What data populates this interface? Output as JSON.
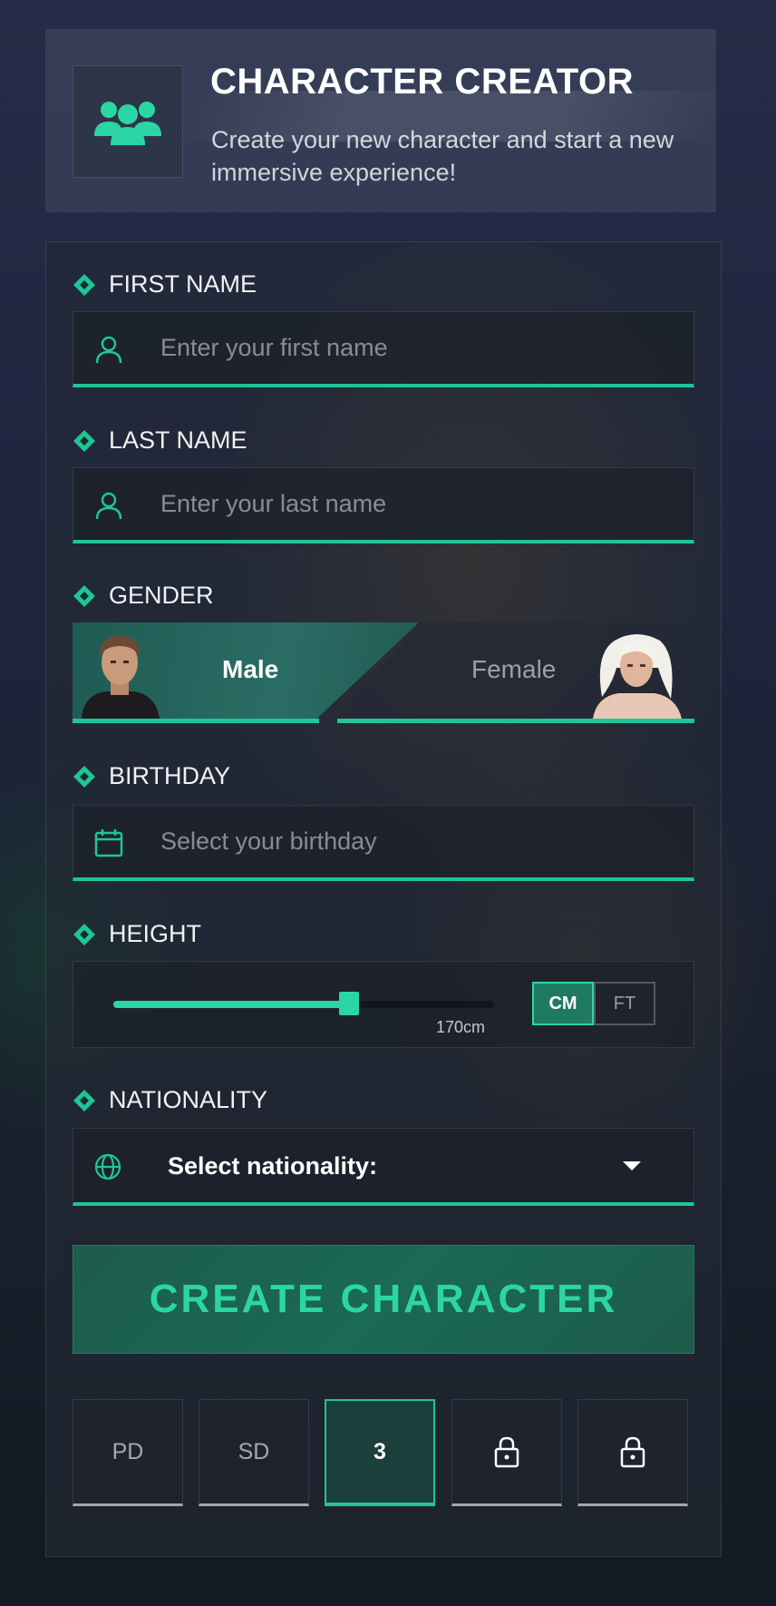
{
  "header": {
    "title": "CHARACTER CREATOR",
    "subtitle": "Create your new character and start a new immersive experience!",
    "icon": "users-icon"
  },
  "form": {
    "first_name": {
      "label": "FIRST NAME",
      "placeholder": "Enter your first name",
      "icon": "user-icon"
    },
    "last_name": {
      "label": "LAST NAME",
      "placeholder": "Enter your last name",
      "icon": "user-icon"
    },
    "gender": {
      "label": "GENDER",
      "options": [
        "Male",
        "Female"
      ],
      "selected": "Male"
    },
    "birthday": {
      "label": "BIRTHDAY",
      "placeholder": "Select your birthday",
      "icon": "calendar-icon"
    },
    "height": {
      "label": "HEIGHT",
      "value_text": "170cm",
      "slider_fraction": 0.62,
      "units": [
        "CM",
        "FT"
      ],
      "selected_unit": "CM"
    },
    "nationality": {
      "label": "NATIONALITY",
      "value": "Select nationality:",
      "icon": "globe-icon"
    }
  },
  "create_button": "CREATE CHARACTER",
  "tabs": [
    "PD",
    "SD",
    "3",
    "lock-icon",
    "lock-icon"
  ],
  "active_tab": "3",
  "colors": {
    "accent": "#20c497",
    "accent_bright": "#2bd6a4"
  }
}
